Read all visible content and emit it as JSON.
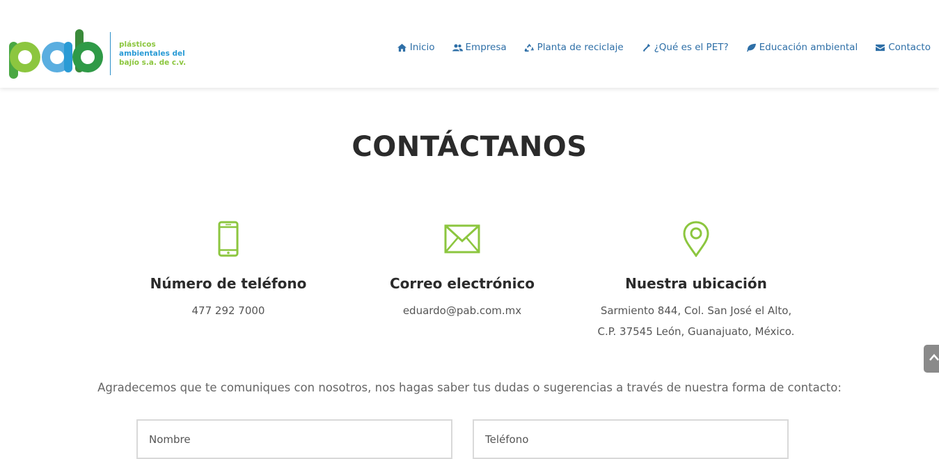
{
  "brand": {
    "logo_text": "pab",
    "tagline": [
      "plásticos",
      "ambientales del",
      "bajío s.a. de c.v."
    ],
    "colors": {
      "green": "#8cc63f",
      "blue": "#2a9bd5",
      "nav": "#2e6fa7"
    }
  },
  "nav": {
    "items": [
      {
        "label": "Inicio",
        "icon": "home-icon"
      },
      {
        "label": "Empresa",
        "icon": "users-icon"
      },
      {
        "label": "Planta de reciclaje",
        "icon": "recycle-icon"
      },
      {
        "label": "¿Qué es el PET?",
        "icon": "bottle-icon"
      },
      {
        "label": "Educación ambiental",
        "icon": "leaf-icon"
      },
      {
        "label": "Contacto",
        "icon": "envelope-icon"
      }
    ]
  },
  "page": {
    "title": "CONTÁCTANOS"
  },
  "contact": {
    "phone": {
      "heading": "Número de teléfono",
      "value": "477 292 7000",
      "icon": "mobile-phone-icon"
    },
    "email": {
      "heading": "Correo electrónico",
      "value": "eduardo@pab.com.mx",
      "icon": "envelope-outline-icon"
    },
    "location": {
      "heading": "Nuestra ubicación",
      "line1": "Sarmiento 844, Col. San José el Alto,",
      "line2": "C.P. 37545 León, Guanajuato, México.",
      "icon": "map-pin-icon"
    },
    "icon_color": "#8cc63f"
  },
  "form": {
    "intro": "Agradecemos que te comuniques con nosotros, nos hagas saber tus dudas o sugerencias a través de nuestra forma de contacto:",
    "name_placeholder": "Nombre",
    "phone_placeholder": "Teléfono"
  }
}
